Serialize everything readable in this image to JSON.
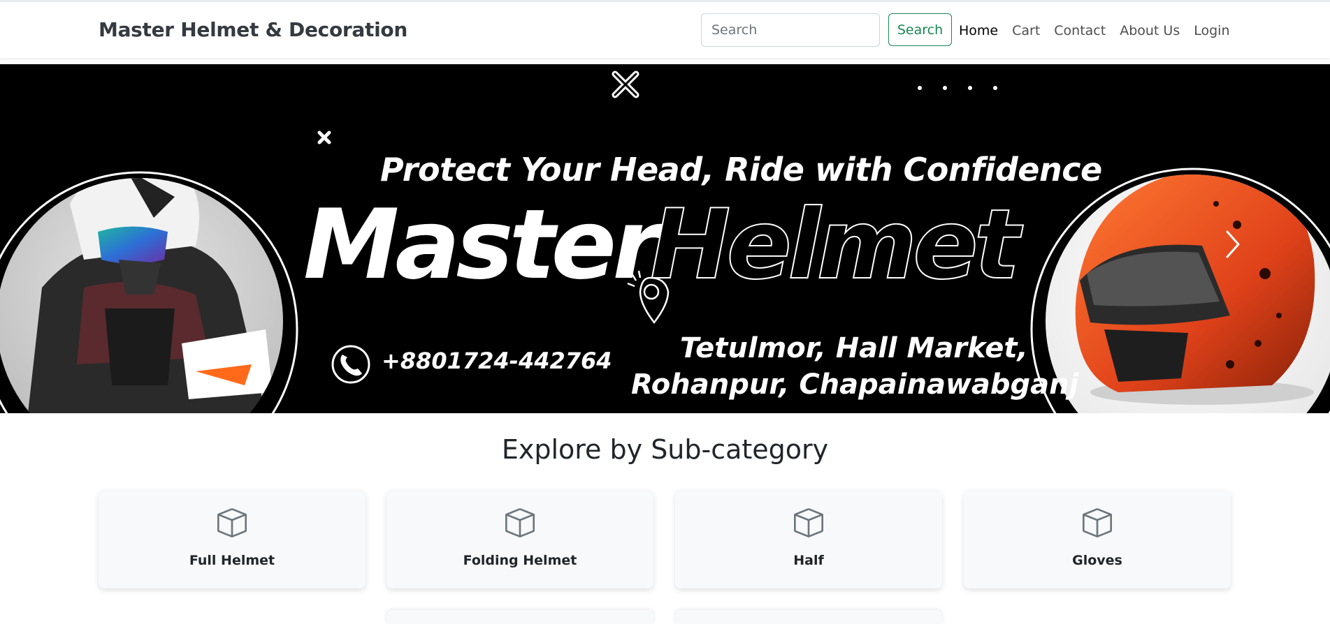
{
  "navbar": {
    "brand": "Master Helmet & Decoration",
    "search_placeholder": "Search",
    "search_button": "Search",
    "links": [
      "Home",
      "Cart",
      "Contact",
      "About Us",
      "Login"
    ],
    "active_link": "Home",
    "accent_color": "#198754"
  },
  "hero": {
    "tagline": "Protect Your Head, Ride with Confidence",
    "brand_word_1": "Master",
    "brand_word_2": "Helmet",
    "phone": "+8801724-442764",
    "address_line1": "Tetulmor, Hall Market,",
    "address_line2": "Rohanpur, Chapainawabganj",
    "background_color": "#000000",
    "next_control_icon": "chevron-right-icon"
  },
  "subcategory_section": {
    "title": "Explore by Sub-category",
    "items": [
      {
        "label": "Full Helmet",
        "icon": "box-icon"
      },
      {
        "label": "Folding Helmet",
        "icon": "box-icon"
      },
      {
        "label": "Half",
        "icon": "box-icon"
      },
      {
        "label": "Gloves",
        "icon": "box-icon"
      }
    ]
  }
}
